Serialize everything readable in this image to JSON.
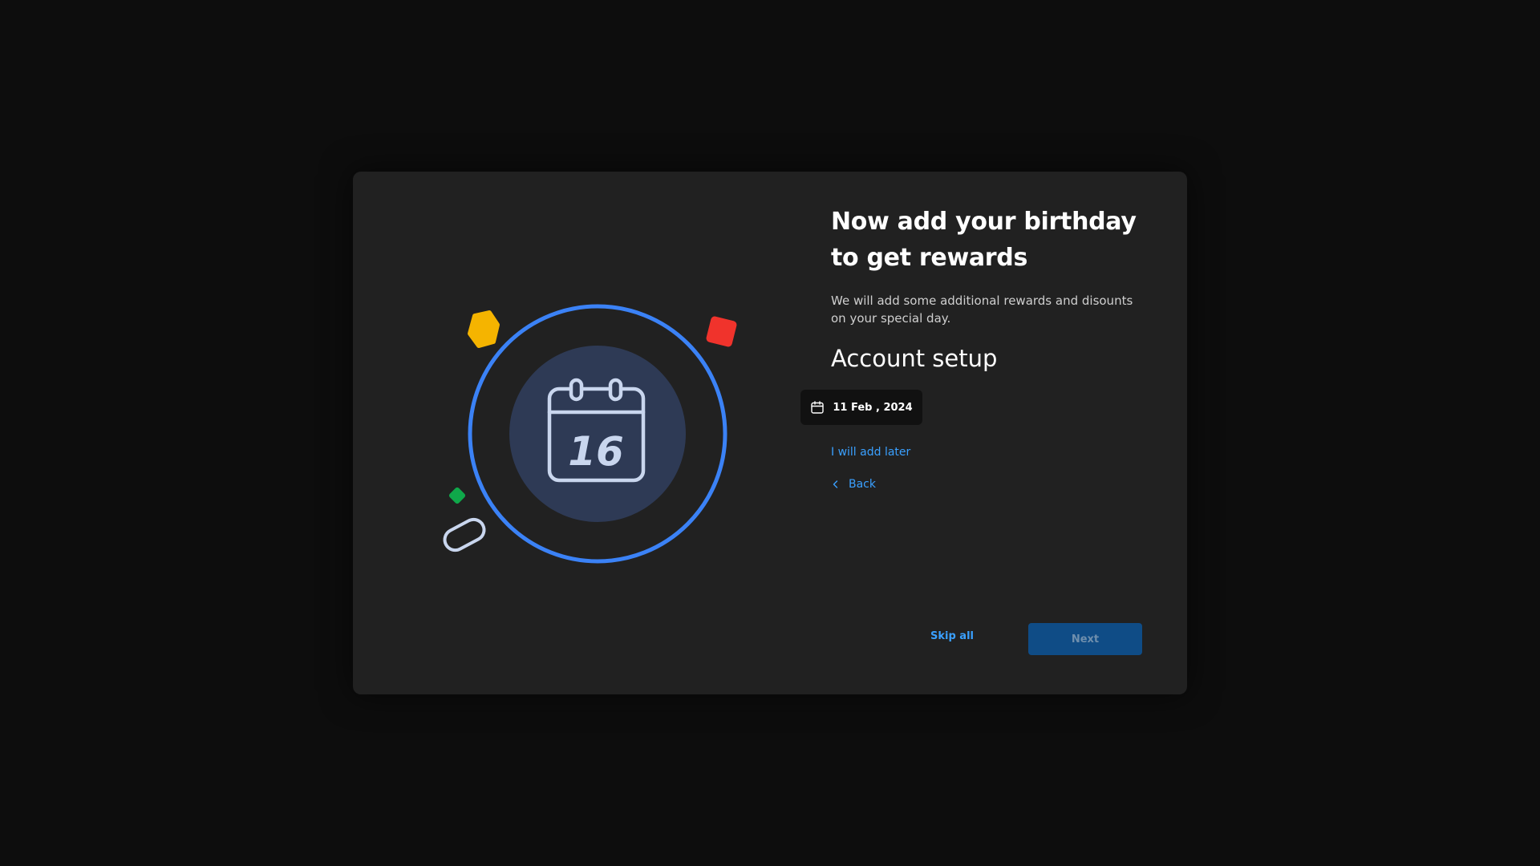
{
  "colors": {
    "page_background": "#0d0d0d",
    "dialog_background": "#212121",
    "accent_blue": "#3b82f6",
    "link_blue": "#3aa0ff",
    "next_button": "#0f4c86",
    "calendar_circle": "#2e3a55",
    "calendar_outline": "#c9d6ee",
    "shape_yellow": "#f5b400",
    "shape_red": "#f0332c",
    "shape_green": "#0fa84a"
  },
  "illustration": {
    "calendar_day": "16",
    "icons": [
      "calendar-icon",
      "hexagon-shape",
      "diamond-shape",
      "pill-shape"
    ]
  },
  "dialog": {
    "title": "Now add your birthday to get rewards",
    "subtitle": "We will add some additional rewards and disounts on your special day.",
    "section_title": "Account setup",
    "date_value": "11 Feb , 2024",
    "date_icon": "calendar-icon",
    "later_link": "I will add later",
    "back_label": "Back",
    "back_icon": "chevron-left-icon"
  },
  "footer": {
    "skip_label": "Skip all",
    "next_label": "Next"
  }
}
